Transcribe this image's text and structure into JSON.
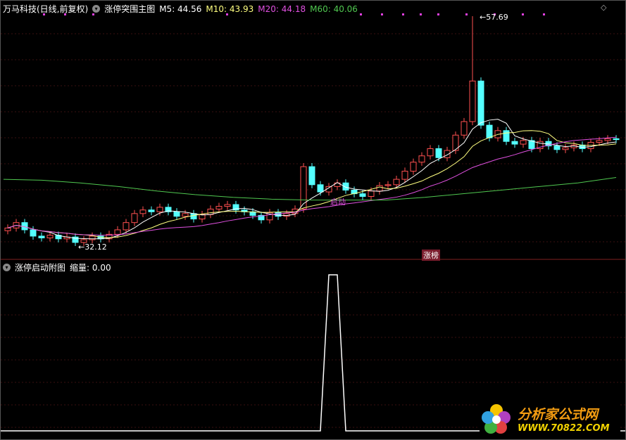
{
  "header": {
    "stock": "万马科技(日线,前复权)",
    "indicator": "涨停突围主图",
    "m5": "M5: 44.56",
    "m10": "M10: 43.93",
    "m20": "M20: 44.18",
    "m60": "M60: 40.06"
  },
  "sub_header": {
    "indicator": "涨停启动附图",
    "value": "缩量: 0.00"
  },
  "labels": {
    "high": "57.69",
    "low": "32.12",
    "signal": "启动",
    "tag": "涨榜"
  },
  "logo": {
    "name": "分析家公式网",
    "url": "WWW.70822.COM"
  },
  "colors": {
    "up": "#ff5050",
    "down": "#54ffff",
    "m5": "#ffffff",
    "m10": "#ffff80",
    "m20": "#e050e0",
    "m60": "#50c850"
  },
  "chart_data": {
    "type": "candlestick",
    "closes": [
      34.2,
      34.8,
      34.0,
      33.3,
      33.1,
      33.4,
      33.0,
      33.2,
      32.6,
      32.9,
      33.3,
      33.0,
      33.5,
      34.0,
      34.8,
      35.8,
      36.2,
      36.0,
      36.5,
      36.0,
      35.5,
      35.8,
      35.2,
      35.7,
      36.3,
      36.6,
      36.8,
      36.2,
      36.0,
      35.6,
      35.1,
      35.9,
      35.5,
      35.8,
      36.3,
      41.0,
      39.0,
      38.2,
      38.8,
      39.2,
      38.4,
      38.0,
      37.7,
      38.3,
      38.9,
      39.0,
      39.6,
      40.5,
      41.5,
      42.2,
      43.0,
      42.0,
      42.8,
      44.5,
      46.0,
      50.5,
      45.6,
      44.2,
      45.0,
      43.8,
      43.5,
      43.9,
      43.0,
      43.8,
      43.3,
      42.9,
      43.1,
      43.4,
      43.0,
      43.7,
      43.9,
      44.1,
      44.0
    ],
    "ma60": [
      39.6,
      39.5,
      39.2,
      38.8,
      38.3,
      37.9,
      37.6,
      37.4,
      37.3,
      37.3,
      37.3,
      37.6,
      38.0,
      38.4,
      38.8,
      39.2,
      39.8
    ],
    "high": 57.69,
    "low": 32.12,
    "signal": {
      "indices": [
        38,
        39
      ]
    }
  }
}
